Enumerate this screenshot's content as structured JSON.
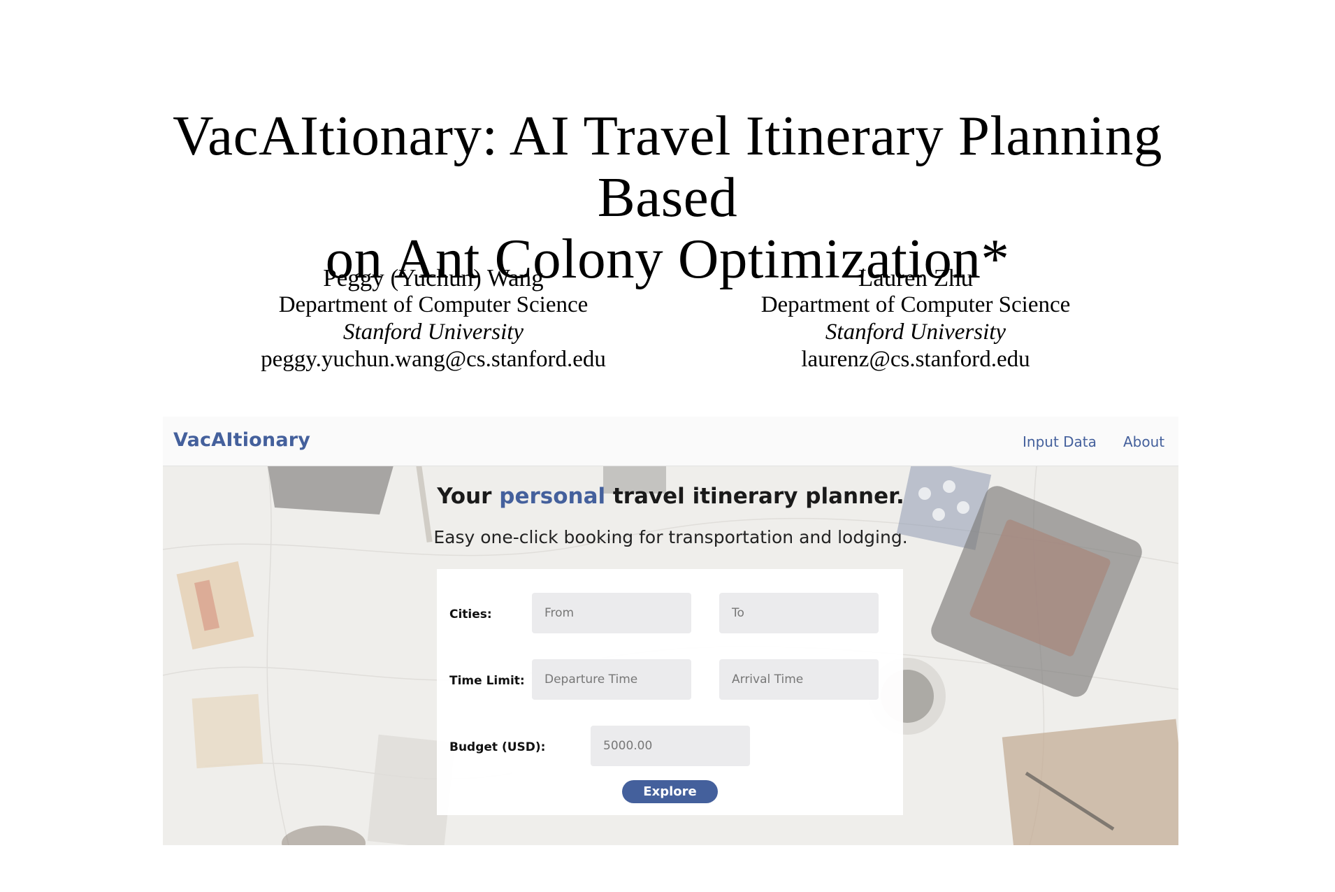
{
  "paper": {
    "title_line1": "VacAItionary: AI Travel Itinerary Planning Based",
    "title_line2": "on Ant Colony Optimization*",
    "authors": [
      {
        "name": "Peggy (Yuchun) Wang",
        "department": "Department of Computer Science",
        "university": "Stanford University",
        "email": "peggy.yuchun.wang@cs.stanford.edu"
      },
      {
        "name": "Lauren Zhu",
        "department": "Department of Computer Science",
        "university": "Stanford University",
        "email": "laurenz@cs.stanford.edu"
      }
    ]
  },
  "app": {
    "brand": "VacAItionary",
    "nav": {
      "input_data": "Input Data",
      "about": "About"
    },
    "headline": {
      "prefix": "Your ",
      "accent": "personal",
      "suffix": " travel itinerary planner."
    },
    "subheadline": "Easy one-click booking for transportation and lodging.",
    "form": {
      "cities_label": "Cities:",
      "from_placeholder": "From",
      "to_placeholder": "To",
      "time_label": "Time Limit:",
      "departure_placeholder": "Departure Time",
      "arrival_placeholder": "Arrival Time",
      "budget_label": "Budget (USD):",
      "budget_value": "5000.00",
      "explore_label": "Explore"
    },
    "colors": {
      "accent": "#44609c",
      "field_bg": "#ebebed"
    }
  }
}
